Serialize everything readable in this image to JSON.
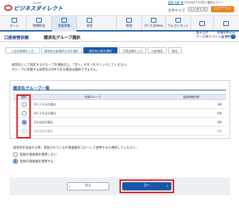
{
  "header": {
    "brand_small": "みんなの",
    "brand": "ビジネスダイレクト",
    "user_name": "愛媛 太郎 様",
    "last_login": "2014年07月30日 最終ログイン",
    "font_size_label": "文字サイズ",
    "font_sizes": [
      "小",
      "中",
      "大"
    ],
    "logout": "ログアウト"
  },
  "nav": {
    "items": [
      {
        "label": "ホーム"
      },
      {
        "label": "明細照会"
      },
      {
        "label": "資金移動"
      },
      {
        "label": "承認"
      },
      {
        "label": "管理"
      },
      {
        "label": "がいためWeb"
      },
      {
        "label": "でんさいネット"
      },
      {
        "label": "電子交付\nサービス"
      },
      {
        "label": "各種お申込み\n・お手続き"
      }
    ]
  },
  "page": {
    "section": "口座振替依頼",
    "title": "請求先グループ選択",
    "screen_id": "BKZF005",
    "help": "ヘルプ",
    "help_icon": "?"
  },
  "steps": [
    "入金先情報を入力",
    "請求先口座選択方法を選択",
    "請求先口座を選択",
    "引落金額を入力",
    "内容確認",
    "確定"
  ],
  "instructions": [
    "請求先として指定するグループを選択の上、「次へ」ボタンをクリックしてください。",
    "グループに所属する請求先が0件である場合は選択できません。"
  ],
  "group_list": {
    "title": "請求先グループ一覧",
    "columns": [
      "選択",
      "所属グループ",
      "登録明細件数"
    ],
    "rows": [
      {
        "group": "01:１０日引落分",
        "count": "3件",
        "checked": false
      },
      {
        "group": "02:２０日引落分",
        "count": "5件",
        "checked": false
      },
      {
        "group": "03:月初引落分",
        "count": "3件",
        "checked": true
      },
      {
        "group": "04:月末引落分",
        "count": "0件",
        "checked": false
      }
    ]
  },
  "options": {
    "prompt": "請求先を追加する際、登録されている引落金額をコピーして使用するか選択してください。",
    "choices": [
      {
        "label": "登録引落金額を使用しない",
        "checked": false
      },
      {
        "label": "登録引落金額を使用する",
        "checked": true
      }
    ]
  },
  "buttons": {
    "back": "戻る",
    "next": "次へ"
  }
}
